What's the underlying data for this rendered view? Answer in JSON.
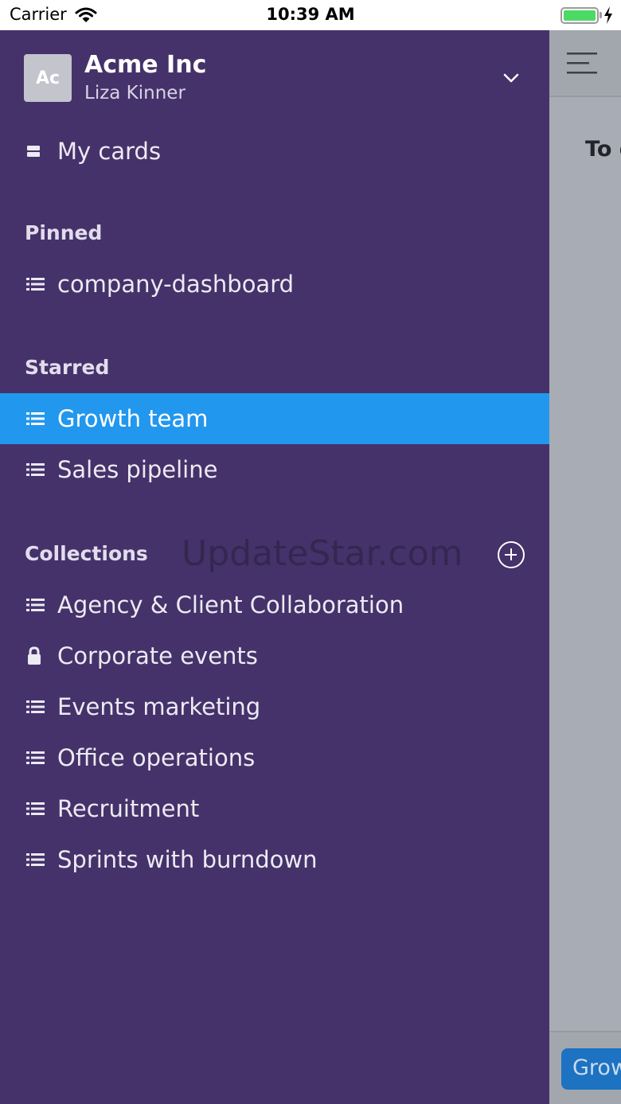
{
  "status_bar": {
    "carrier": "Carrier",
    "time": "10:39 AM",
    "battery_level": 1.0
  },
  "workspace": {
    "avatar_initials": "Ac",
    "name": "Acme Inc",
    "user": "Liza Kinner"
  },
  "my_cards": {
    "label": "My cards",
    "icon": "cards-icon"
  },
  "sections": {
    "pinned": "Pinned",
    "starred": "Starred",
    "collections": "Collections"
  },
  "pinned": [
    {
      "label": "company-dashboard",
      "icon": "list-icon"
    }
  ],
  "starred": [
    {
      "label": "Growth team",
      "icon": "list-icon",
      "active": true
    },
    {
      "label": "Sales pipeline",
      "icon": "list-icon"
    }
  ],
  "collections": [
    {
      "label": "Agency & Client Collaboration",
      "icon": "list-icon"
    },
    {
      "label": "Corporate events",
      "icon": "lock-icon"
    },
    {
      "label": "Events marketing",
      "icon": "list-icon"
    },
    {
      "label": "Office operations",
      "icon": "list-icon"
    },
    {
      "label": "Recruitment",
      "icon": "list-icon"
    },
    {
      "label": "Sprints with burndown",
      "icon": "list-icon"
    }
  ],
  "watermark": "UpdateStar.com",
  "background_panel": {
    "heading": "To d",
    "bottom_button": "Grow"
  },
  "colors": {
    "drawer": "#45326a",
    "active": "#2297ee",
    "overlay": "#a8adb5",
    "button": "#1d72c2"
  }
}
